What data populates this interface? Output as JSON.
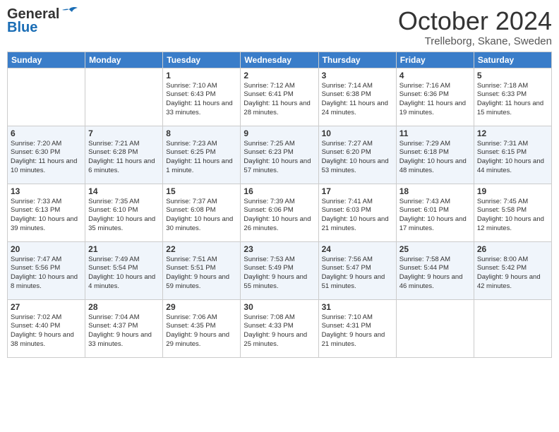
{
  "header": {
    "logo_line1": "General",
    "logo_line2": "Blue",
    "month_title": "October 2024",
    "subtitle": "Trelleborg, Skane, Sweden"
  },
  "weekdays": [
    "Sunday",
    "Monday",
    "Tuesday",
    "Wednesday",
    "Thursday",
    "Friday",
    "Saturday"
  ],
  "weeks": [
    [
      {
        "day": "",
        "sunrise": "",
        "sunset": "",
        "daylight": ""
      },
      {
        "day": "",
        "sunrise": "",
        "sunset": "",
        "daylight": ""
      },
      {
        "day": "1",
        "sunrise": "Sunrise: 7:10 AM",
        "sunset": "Sunset: 6:43 PM",
        "daylight": "Daylight: 11 hours and 33 minutes."
      },
      {
        "day": "2",
        "sunrise": "Sunrise: 7:12 AM",
        "sunset": "Sunset: 6:41 PM",
        "daylight": "Daylight: 11 hours and 28 minutes."
      },
      {
        "day": "3",
        "sunrise": "Sunrise: 7:14 AM",
        "sunset": "Sunset: 6:38 PM",
        "daylight": "Daylight: 11 hours and 24 minutes."
      },
      {
        "day": "4",
        "sunrise": "Sunrise: 7:16 AM",
        "sunset": "Sunset: 6:36 PM",
        "daylight": "Daylight: 11 hours and 19 minutes."
      },
      {
        "day": "5",
        "sunrise": "Sunrise: 7:18 AM",
        "sunset": "Sunset: 6:33 PM",
        "daylight": "Daylight: 11 hours and 15 minutes."
      }
    ],
    [
      {
        "day": "6",
        "sunrise": "Sunrise: 7:20 AM",
        "sunset": "Sunset: 6:30 PM",
        "daylight": "Daylight: 11 hours and 10 minutes."
      },
      {
        "day": "7",
        "sunrise": "Sunrise: 7:21 AM",
        "sunset": "Sunset: 6:28 PM",
        "daylight": "Daylight: 11 hours and 6 minutes."
      },
      {
        "day": "8",
        "sunrise": "Sunrise: 7:23 AM",
        "sunset": "Sunset: 6:25 PM",
        "daylight": "Daylight: 11 hours and 1 minute."
      },
      {
        "day": "9",
        "sunrise": "Sunrise: 7:25 AM",
        "sunset": "Sunset: 6:23 PM",
        "daylight": "Daylight: 10 hours and 57 minutes."
      },
      {
        "day": "10",
        "sunrise": "Sunrise: 7:27 AM",
        "sunset": "Sunset: 6:20 PM",
        "daylight": "Daylight: 10 hours and 53 minutes."
      },
      {
        "day": "11",
        "sunrise": "Sunrise: 7:29 AM",
        "sunset": "Sunset: 6:18 PM",
        "daylight": "Daylight: 10 hours and 48 minutes."
      },
      {
        "day": "12",
        "sunrise": "Sunrise: 7:31 AM",
        "sunset": "Sunset: 6:15 PM",
        "daylight": "Daylight: 10 hours and 44 minutes."
      }
    ],
    [
      {
        "day": "13",
        "sunrise": "Sunrise: 7:33 AM",
        "sunset": "Sunset: 6:13 PM",
        "daylight": "Daylight: 10 hours and 39 minutes."
      },
      {
        "day": "14",
        "sunrise": "Sunrise: 7:35 AM",
        "sunset": "Sunset: 6:10 PM",
        "daylight": "Daylight: 10 hours and 35 minutes."
      },
      {
        "day": "15",
        "sunrise": "Sunrise: 7:37 AM",
        "sunset": "Sunset: 6:08 PM",
        "daylight": "Daylight: 10 hours and 30 minutes."
      },
      {
        "day": "16",
        "sunrise": "Sunrise: 7:39 AM",
        "sunset": "Sunset: 6:06 PM",
        "daylight": "Daylight: 10 hours and 26 minutes."
      },
      {
        "day": "17",
        "sunrise": "Sunrise: 7:41 AM",
        "sunset": "Sunset: 6:03 PM",
        "daylight": "Daylight: 10 hours and 21 minutes."
      },
      {
        "day": "18",
        "sunrise": "Sunrise: 7:43 AM",
        "sunset": "Sunset: 6:01 PM",
        "daylight": "Daylight: 10 hours and 17 minutes."
      },
      {
        "day": "19",
        "sunrise": "Sunrise: 7:45 AM",
        "sunset": "Sunset: 5:58 PM",
        "daylight": "Daylight: 10 hours and 12 minutes."
      }
    ],
    [
      {
        "day": "20",
        "sunrise": "Sunrise: 7:47 AM",
        "sunset": "Sunset: 5:56 PM",
        "daylight": "Daylight: 10 hours and 8 minutes."
      },
      {
        "day": "21",
        "sunrise": "Sunrise: 7:49 AM",
        "sunset": "Sunset: 5:54 PM",
        "daylight": "Daylight: 10 hours and 4 minutes."
      },
      {
        "day": "22",
        "sunrise": "Sunrise: 7:51 AM",
        "sunset": "Sunset: 5:51 PM",
        "daylight": "Daylight: 9 hours and 59 minutes."
      },
      {
        "day": "23",
        "sunrise": "Sunrise: 7:53 AM",
        "sunset": "Sunset: 5:49 PM",
        "daylight": "Daylight: 9 hours and 55 minutes."
      },
      {
        "day": "24",
        "sunrise": "Sunrise: 7:56 AM",
        "sunset": "Sunset: 5:47 PM",
        "daylight": "Daylight: 9 hours and 51 minutes."
      },
      {
        "day": "25",
        "sunrise": "Sunrise: 7:58 AM",
        "sunset": "Sunset: 5:44 PM",
        "daylight": "Daylight: 9 hours and 46 minutes."
      },
      {
        "day": "26",
        "sunrise": "Sunrise: 8:00 AM",
        "sunset": "Sunset: 5:42 PM",
        "daylight": "Daylight: 9 hours and 42 minutes."
      }
    ],
    [
      {
        "day": "27",
        "sunrise": "Sunrise: 7:02 AM",
        "sunset": "Sunset: 4:40 PM",
        "daylight": "Daylight: 9 hours and 38 minutes."
      },
      {
        "day": "28",
        "sunrise": "Sunrise: 7:04 AM",
        "sunset": "Sunset: 4:37 PM",
        "daylight": "Daylight: 9 hours and 33 minutes."
      },
      {
        "day": "29",
        "sunrise": "Sunrise: 7:06 AM",
        "sunset": "Sunset: 4:35 PM",
        "daylight": "Daylight: 9 hours and 29 minutes."
      },
      {
        "day": "30",
        "sunrise": "Sunrise: 7:08 AM",
        "sunset": "Sunset: 4:33 PM",
        "daylight": "Daylight: 9 hours and 25 minutes."
      },
      {
        "day": "31",
        "sunrise": "Sunrise: 7:10 AM",
        "sunset": "Sunset: 4:31 PM",
        "daylight": "Daylight: 9 hours and 21 minutes."
      },
      {
        "day": "",
        "sunrise": "",
        "sunset": "",
        "daylight": ""
      },
      {
        "day": "",
        "sunrise": "",
        "sunset": "",
        "daylight": ""
      }
    ]
  ]
}
